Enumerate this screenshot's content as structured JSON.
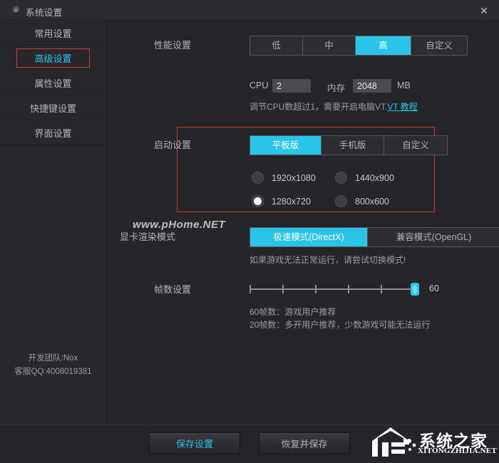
{
  "window": {
    "title": "系统设置",
    "gear_icon": "gear-icon",
    "close_label": "✕"
  },
  "theme": {
    "accent": "#29c4e8",
    "panel_bg": "#26262a",
    "sidebar_bg": "#28282c",
    "annotation": "#c43a3a",
    "text": "#b4b4ba"
  },
  "sidebar": {
    "items": [
      {
        "label": "常用设置",
        "active": false
      },
      {
        "label": "高级设置",
        "active": true
      },
      {
        "label": "属性设置",
        "active": false
      },
      {
        "label": "快捷键设置",
        "active": false
      },
      {
        "label": "界面设置",
        "active": false
      }
    ],
    "footer": {
      "team": "开发团队:Nox",
      "support": "客服QQ:4008019381"
    }
  },
  "main": {
    "performance": {
      "label": "性能设置",
      "options": [
        "低",
        "中",
        "高",
        "自定义"
      ],
      "selected": "高",
      "widths": [
        72,
        72,
        80,
        80
      ]
    },
    "cpu": {
      "label": "CPU",
      "value": "2"
    },
    "memory": {
      "label": "内存",
      "value": "2048",
      "unit": "MB"
    },
    "vt_hint": {
      "text": "调节CPU数超过1，需要开启电脑VT.",
      "link": "VT 教程"
    },
    "startup": {
      "label": "启动设置",
      "options": [
        "平板版",
        "手机版",
        "自定义"
      ],
      "selected": "平板版",
      "widths": [
        98,
        90,
        90
      ],
      "resolutions": [
        {
          "label": "1920x1080",
          "checked": false
        },
        {
          "label": "1440x900",
          "checked": false
        },
        {
          "label": "1280x720",
          "checked": true
        },
        {
          "label": "800x600",
          "checked": false
        }
      ]
    },
    "render": {
      "label": "显卡渲染模式",
      "options": [
        "极速模式(DirectX)",
        "兼容模式(OpenGL)"
      ],
      "selected": "极速模式(DirectX)",
      "widths": [
        166,
        186
      ],
      "hint": "如果游戏无法正常运行，请尝试切换模式!"
    },
    "fps": {
      "label": "帧数设置",
      "value": "60",
      "min": 10,
      "max": 60,
      "ticks": 6,
      "hint_line_1": "60帧数：游戏用户推荐",
      "hint_line_2": "20帧数：多开用户推荐，少数游戏可能无法运行"
    }
  },
  "footer": {
    "save_label": "保存设置",
    "restore_label": "恢复并保存"
  },
  "watermarks": {
    "site_text": "www.pHome.NET",
    "logo_cn": "系统之家",
    "logo_en": "XITONGZHIJIA.NET"
  }
}
